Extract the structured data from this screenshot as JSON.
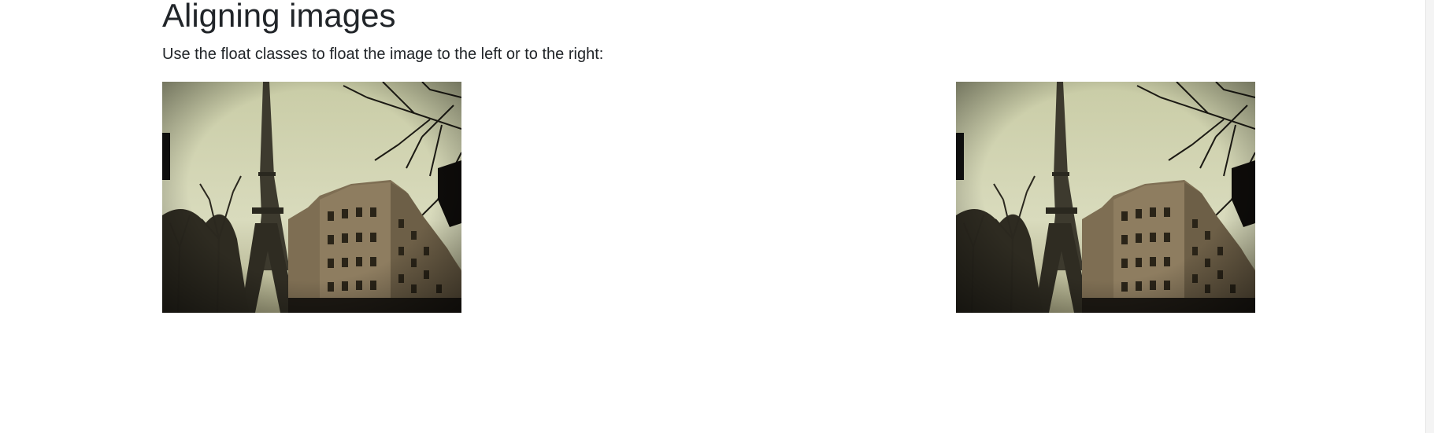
{
  "heading": "Aligning images",
  "description": "Use the float classes to float the image to the left or to the right:",
  "images": [
    {
      "alt": "Paris",
      "float": "left",
      "icon": "eiffel-tower-photo"
    },
    {
      "alt": "Paris",
      "float": "right",
      "icon": "eiffel-tower-photo"
    }
  ],
  "colors": {
    "text": "#212529",
    "sky": "#d6d8b8",
    "building": "#8c7a5e",
    "dark": "#1e1a14"
  }
}
